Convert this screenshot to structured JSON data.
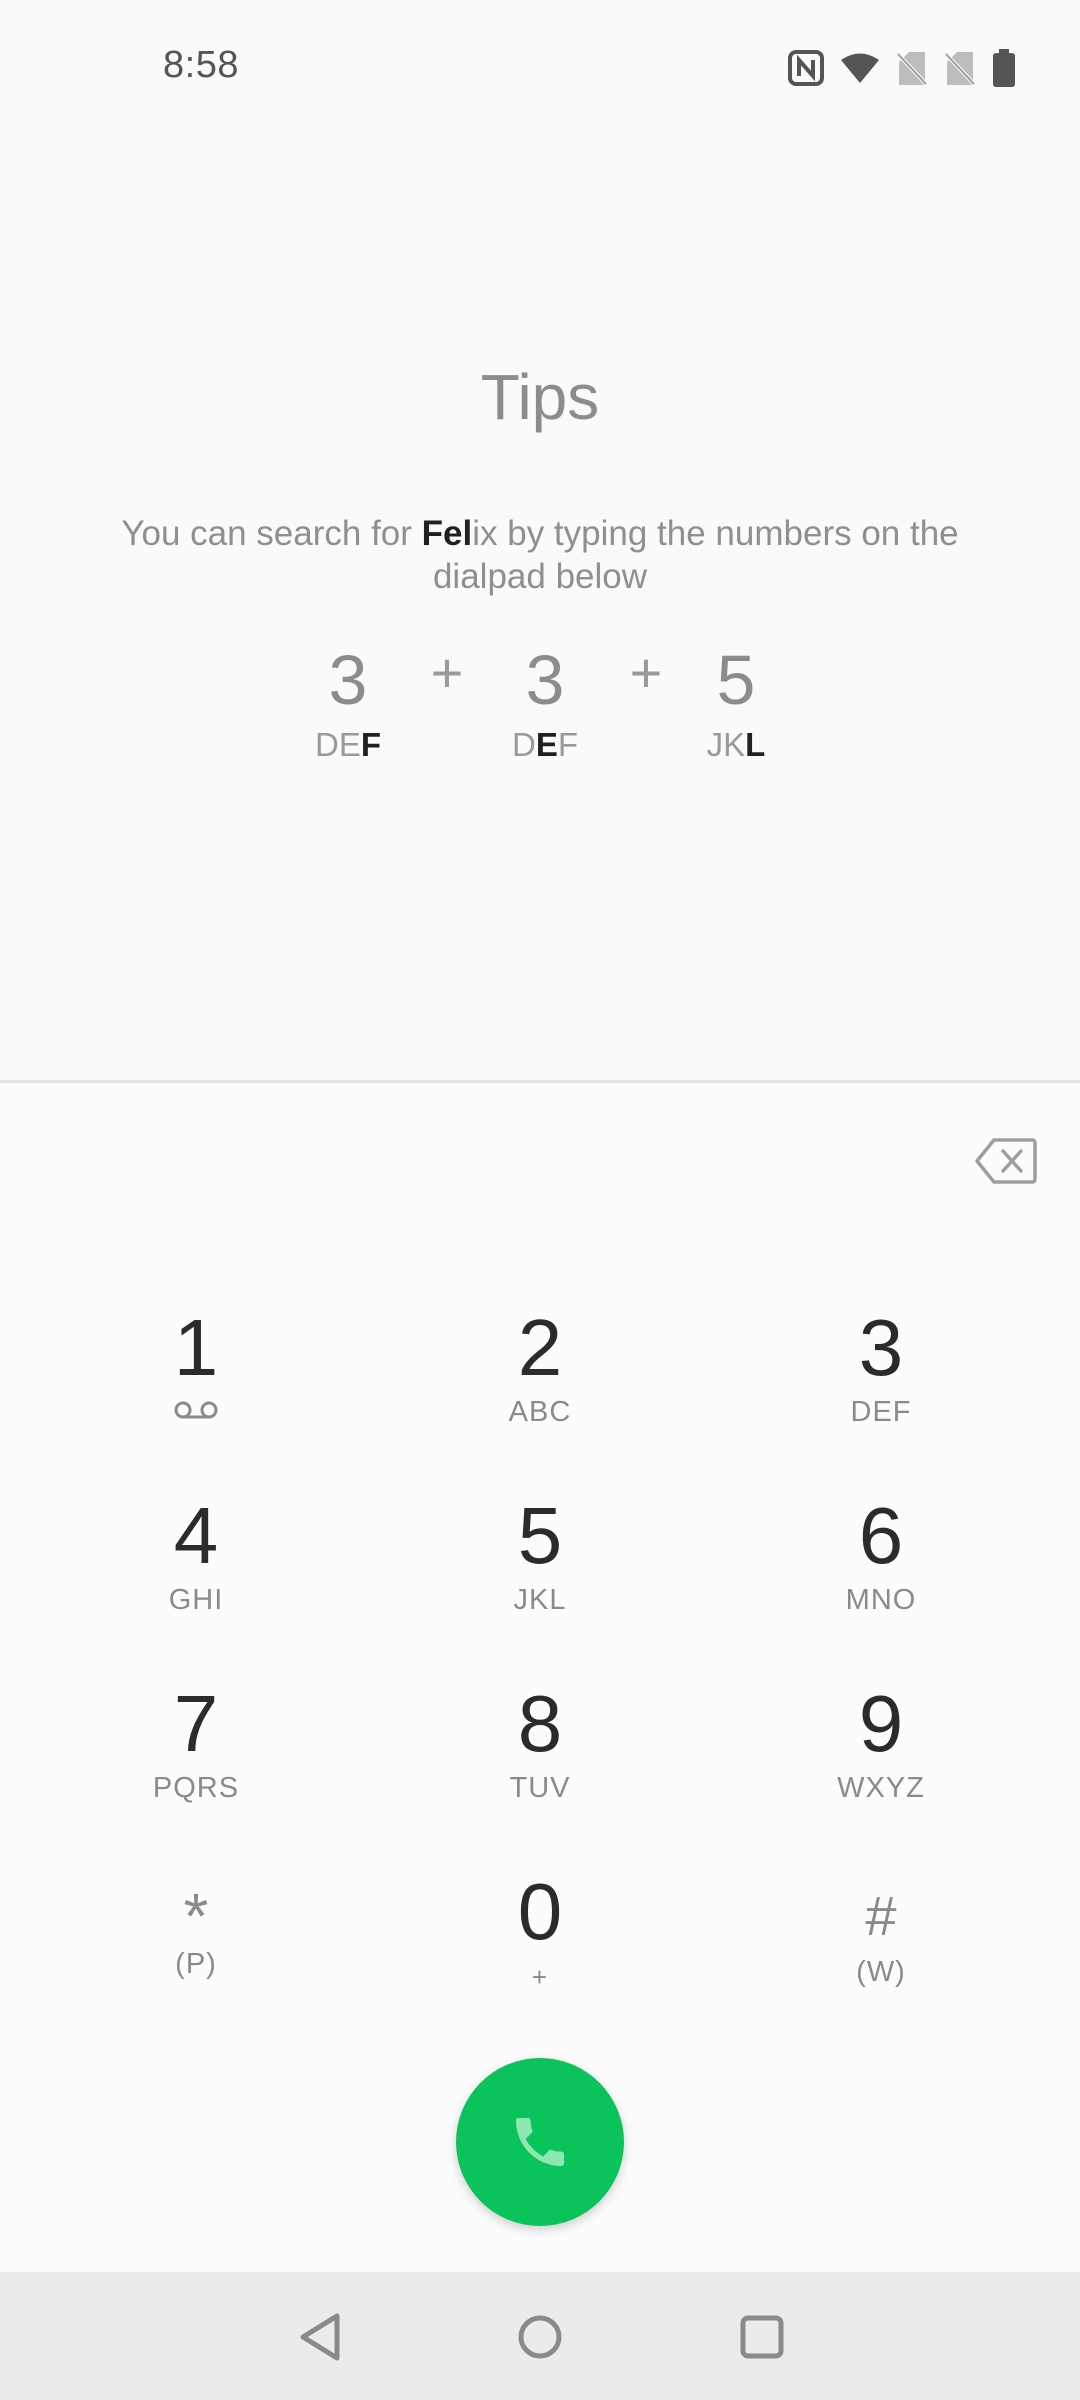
{
  "status_bar": {
    "time": "8:58",
    "icons": [
      "nfc-icon",
      "wifi-icon",
      "no-sim-icon",
      "no-sim-icon",
      "battery-icon"
    ]
  },
  "tips": {
    "title": "Tips",
    "description_prefix": "You can search for ",
    "description_highlight": "Fel",
    "description_suffix": "ix by typing the numbers on the dialpad below",
    "example": [
      {
        "digit": "3",
        "letters_plain": "DE",
        "letters_bold": "F",
        "letters_after": ""
      },
      {
        "digit": "3",
        "letters_plain": "D",
        "letters_bold": "E",
        "letters_after": "F"
      },
      {
        "digit": "5",
        "letters_plain": "JK",
        "letters_bold": "L",
        "letters_after": ""
      }
    ],
    "plus": "+"
  },
  "dialpad": {
    "keys": [
      {
        "digit": "1",
        "sub": ""
      },
      {
        "digit": "2",
        "sub": "ABC"
      },
      {
        "digit": "3",
        "sub": "DEF"
      },
      {
        "digit": "4",
        "sub": "GHI"
      },
      {
        "digit": "5",
        "sub": "JKL"
      },
      {
        "digit": "6",
        "sub": "MNO"
      },
      {
        "digit": "7",
        "sub": "PQRS"
      },
      {
        "digit": "8",
        "sub": "TUV"
      },
      {
        "digit": "9",
        "sub": "WXYZ"
      },
      {
        "digit": "*",
        "sub": "(P)"
      },
      {
        "digit": "0",
        "sub": "+"
      },
      {
        "digit": "#",
        "sub": "(W)"
      }
    ]
  },
  "colors": {
    "call_button": "#0ac35a",
    "background": "#fafafa",
    "nav_bar": "#ebebeb"
  }
}
